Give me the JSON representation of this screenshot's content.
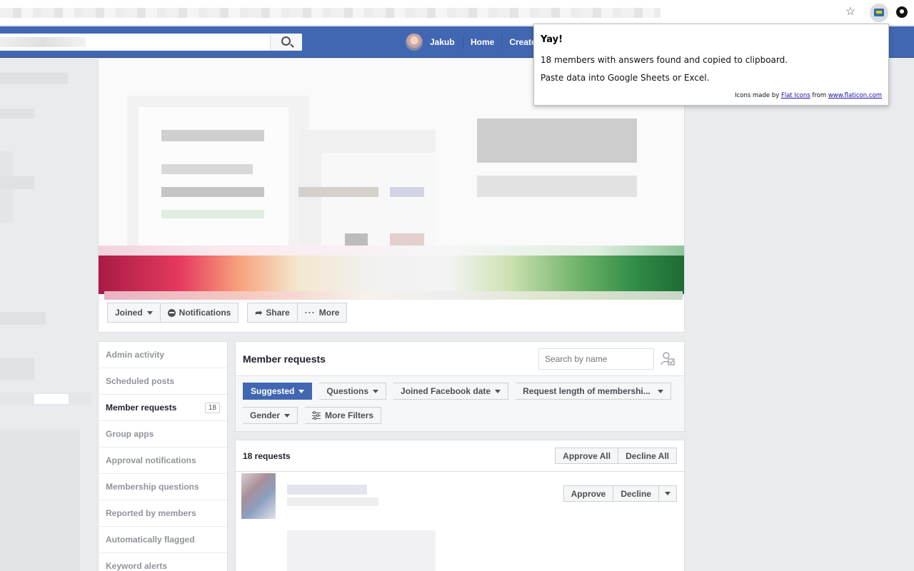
{
  "browser": {
    "star_icon": "star-icon",
    "extension_icons": [
      "extension-icon",
      "extension-2-icon"
    ]
  },
  "nav": {
    "user_name": "Jakub",
    "home": "Home",
    "create": "Create"
  },
  "group_actions": {
    "joined": "Joined",
    "notifications": "Notifications",
    "share": "Share",
    "more": "More"
  },
  "side_menu": {
    "items": [
      {
        "label": "Admin activity"
      },
      {
        "label": "Scheduled posts"
      },
      {
        "label": "Member requests",
        "badge": "18"
      },
      {
        "label": "Group apps"
      },
      {
        "label": "Approval notifications"
      },
      {
        "label": "Membership questions"
      },
      {
        "label": "Reported by members"
      },
      {
        "label": "Automatically flagged"
      },
      {
        "label": "Keyword alerts"
      }
    ]
  },
  "requests": {
    "title": "Member requests",
    "search_placeholder": "Search by name",
    "filters": {
      "suggested": "Suggested",
      "questions": "Questions",
      "joined_date": "Joined Facebook date",
      "request_length": "Request length of membershi...",
      "gender": "Gender",
      "more_filters": "More Filters"
    },
    "count_label": "18 requests",
    "approve_all": "Approve All",
    "decline_all": "Decline All",
    "row": {
      "approve": "Approve",
      "decline": "Decline"
    }
  },
  "popup": {
    "title": "Yay!",
    "line1": "18 members with answers found and copied to clipboard.",
    "line2": "Paste data into Google Sheets or Excel.",
    "credit_prefix": "Icons made by",
    "credit_link1": "Flat Icons",
    "credit_mid": "from",
    "credit_link2": "www.flaticon.com"
  },
  "colors": {
    "fb_blue": "#4267b2",
    "page_bg": "#e9ebee"
  }
}
